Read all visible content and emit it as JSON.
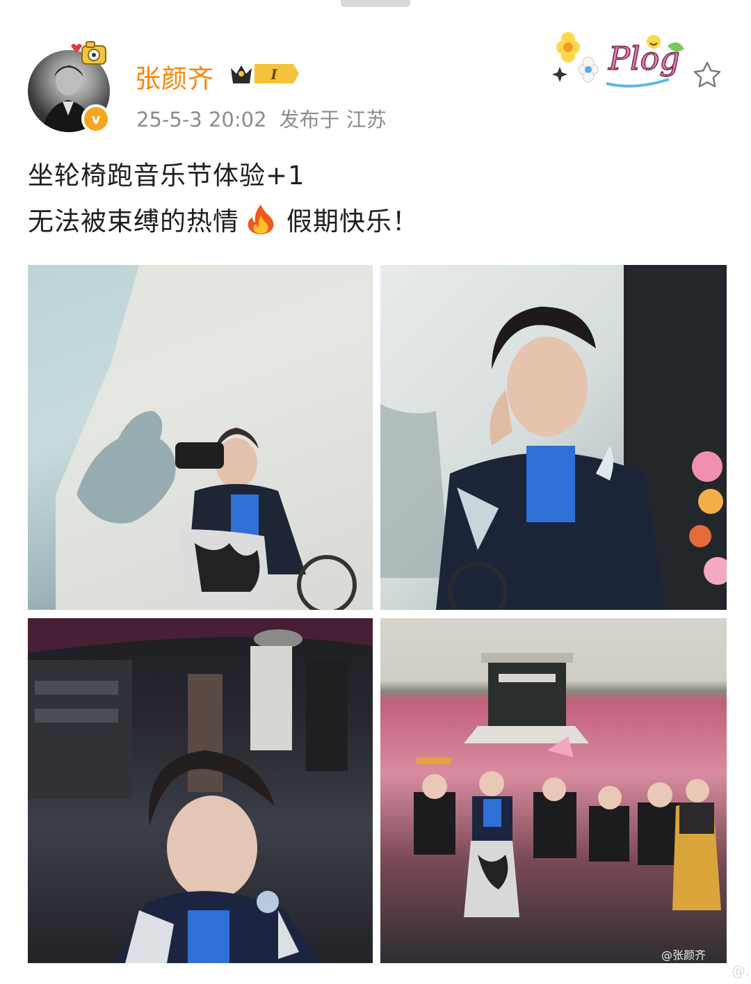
{
  "post": {
    "author": {
      "name": "张颜齐",
      "member_level": "I",
      "verified_mark": "v"
    },
    "time": "25-5-3 20:02",
    "location": "发布于 江苏",
    "sticker_text": "Plog",
    "text_line1": "坐轮椅跑音乐节体验+1",
    "text_line2_before": "无法被束缚的热情",
    "text_line2_emoji": "fire-icon",
    "text_line2_after": "假期快乐！",
    "photo_watermark": "@张颜齐",
    "page_watermark": "@..."
  },
  "icons": {
    "favorite": "star-outline-icon",
    "verified": "verified-badge-icon",
    "avatar_pendant": "camera-pendant-icon"
  },
  "colors": {
    "username": "#ff8200",
    "meta": "#8c8c8c",
    "verified": "#f6a623",
    "text": "#1e1e1e"
  }
}
